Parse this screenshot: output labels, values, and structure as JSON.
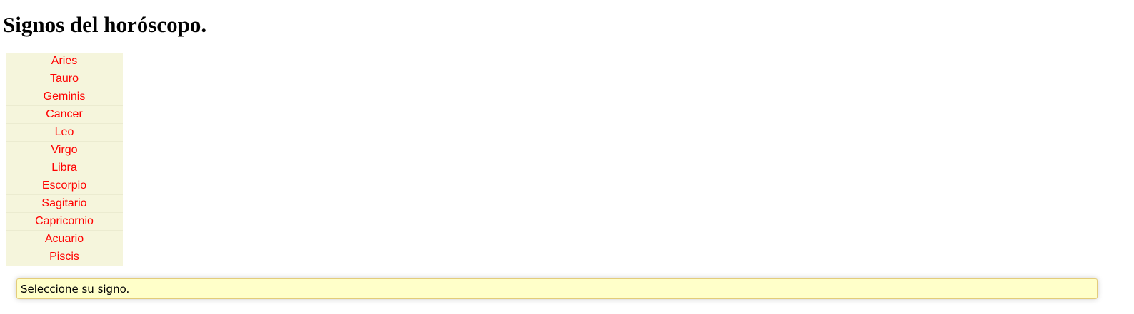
{
  "page": {
    "title": "Signos del horóscopo."
  },
  "signs": [
    {
      "label": "Aries"
    },
    {
      "label": "Tauro"
    },
    {
      "label": "Geminis"
    },
    {
      "label": "Cancer"
    },
    {
      "label": "Leo"
    },
    {
      "label": "Virgo"
    },
    {
      "label": "Libra"
    },
    {
      "label": "Escorpio"
    },
    {
      "label": "Sagitario"
    },
    {
      "label": "Capricornio"
    },
    {
      "label": "Acuario"
    },
    {
      "label": "Piscis"
    }
  ],
  "message": {
    "text": "Seleccione su signo."
  },
  "colors": {
    "link": "#ff0000",
    "list_background": "#f5f5dc",
    "message_background": "#ffffc9",
    "message_border": "#e3cc7a"
  }
}
